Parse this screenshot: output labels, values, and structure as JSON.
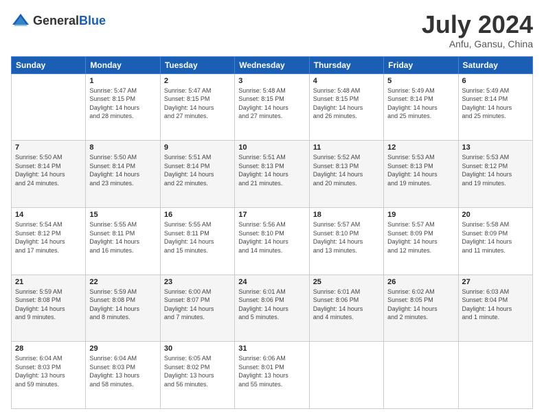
{
  "logo": {
    "general": "General",
    "blue": "Blue"
  },
  "title": {
    "month": "July 2024",
    "location": "Anfu, Gansu, China"
  },
  "weekdays": [
    "Sunday",
    "Monday",
    "Tuesday",
    "Wednesday",
    "Thursday",
    "Friday",
    "Saturday"
  ],
  "weeks": [
    [
      {
        "day": "",
        "info": ""
      },
      {
        "day": "1",
        "info": "Sunrise: 5:47 AM\nSunset: 8:15 PM\nDaylight: 14 hours\nand 28 minutes."
      },
      {
        "day": "2",
        "info": "Sunrise: 5:47 AM\nSunset: 8:15 PM\nDaylight: 14 hours\nand 27 minutes."
      },
      {
        "day": "3",
        "info": "Sunrise: 5:48 AM\nSunset: 8:15 PM\nDaylight: 14 hours\nand 27 minutes."
      },
      {
        "day": "4",
        "info": "Sunrise: 5:48 AM\nSunset: 8:15 PM\nDaylight: 14 hours\nand 26 minutes."
      },
      {
        "day": "5",
        "info": "Sunrise: 5:49 AM\nSunset: 8:14 PM\nDaylight: 14 hours\nand 25 minutes."
      },
      {
        "day": "6",
        "info": "Sunrise: 5:49 AM\nSunset: 8:14 PM\nDaylight: 14 hours\nand 25 minutes."
      }
    ],
    [
      {
        "day": "7",
        "info": "Sunrise: 5:50 AM\nSunset: 8:14 PM\nDaylight: 14 hours\nand 24 minutes."
      },
      {
        "day": "8",
        "info": "Sunrise: 5:50 AM\nSunset: 8:14 PM\nDaylight: 14 hours\nand 23 minutes."
      },
      {
        "day": "9",
        "info": "Sunrise: 5:51 AM\nSunset: 8:14 PM\nDaylight: 14 hours\nand 22 minutes."
      },
      {
        "day": "10",
        "info": "Sunrise: 5:51 AM\nSunset: 8:13 PM\nDaylight: 14 hours\nand 21 minutes."
      },
      {
        "day": "11",
        "info": "Sunrise: 5:52 AM\nSunset: 8:13 PM\nDaylight: 14 hours\nand 20 minutes."
      },
      {
        "day": "12",
        "info": "Sunrise: 5:53 AM\nSunset: 8:13 PM\nDaylight: 14 hours\nand 19 minutes."
      },
      {
        "day": "13",
        "info": "Sunrise: 5:53 AM\nSunset: 8:12 PM\nDaylight: 14 hours\nand 19 minutes."
      }
    ],
    [
      {
        "day": "14",
        "info": "Sunrise: 5:54 AM\nSunset: 8:12 PM\nDaylight: 14 hours\nand 17 minutes."
      },
      {
        "day": "15",
        "info": "Sunrise: 5:55 AM\nSunset: 8:11 PM\nDaylight: 14 hours\nand 16 minutes."
      },
      {
        "day": "16",
        "info": "Sunrise: 5:55 AM\nSunset: 8:11 PM\nDaylight: 14 hours\nand 15 minutes."
      },
      {
        "day": "17",
        "info": "Sunrise: 5:56 AM\nSunset: 8:10 PM\nDaylight: 14 hours\nand 14 minutes."
      },
      {
        "day": "18",
        "info": "Sunrise: 5:57 AM\nSunset: 8:10 PM\nDaylight: 14 hours\nand 13 minutes."
      },
      {
        "day": "19",
        "info": "Sunrise: 5:57 AM\nSunset: 8:09 PM\nDaylight: 14 hours\nand 12 minutes."
      },
      {
        "day": "20",
        "info": "Sunrise: 5:58 AM\nSunset: 8:09 PM\nDaylight: 14 hours\nand 11 minutes."
      }
    ],
    [
      {
        "day": "21",
        "info": "Sunrise: 5:59 AM\nSunset: 8:08 PM\nDaylight: 14 hours\nand 9 minutes."
      },
      {
        "day": "22",
        "info": "Sunrise: 5:59 AM\nSunset: 8:08 PM\nDaylight: 14 hours\nand 8 minutes."
      },
      {
        "day": "23",
        "info": "Sunrise: 6:00 AM\nSunset: 8:07 PM\nDaylight: 14 hours\nand 7 minutes."
      },
      {
        "day": "24",
        "info": "Sunrise: 6:01 AM\nSunset: 8:06 PM\nDaylight: 14 hours\nand 5 minutes."
      },
      {
        "day": "25",
        "info": "Sunrise: 6:01 AM\nSunset: 8:06 PM\nDaylight: 14 hours\nand 4 minutes."
      },
      {
        "day": "26",
        "info": "Sunrise: 6:02 AM\nSunset: 8:05 PM\nDaylight: 14 hours\nand 2 minutes."
      },
      {
        "day": "27",
        "info": "Sunrise: 6:03 AM\nSunset: 8:04 PM\nDaylight: 14 hours\nand 1 minute."
      }
    ],
    [
      {
        "day": "28",
        "info": "Sunrise: 6:04 AM\nSunset: 8:03 PM\nDaylight: 13 hours\nand 59 minutes."
      },
      {
        "day": "29",
        "info": "Sunrise: 6:04 AM\nSunset: 8:03 PM\nDaylight: 13 hours\nand 58 minutes."
      },
      {
        "day": "30",
        "info": "Sunrise: 6:05 AM\nSunset: 8:02 PM\nDaylight: 13 hours\nand 56 minutes."
      },
      {
        "day": "31",
        "info": "Sunrise: 6:06 AM\nSunset: 8:01 PM\nDaylight: 13 hours\nand 55 minutes."
      },
      {
        "day": "",
        "info": ""
      },
      {
        "day": "",
        "info": ""
      },
      {
        "day": "",
        "info": ""
      }
    ]
  ]
}
